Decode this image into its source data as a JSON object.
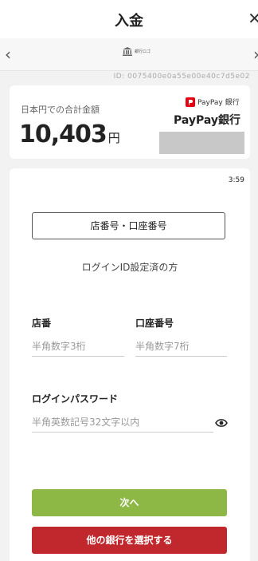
{
  "header": {
    "title": "入金",
    "close_icon": "close-icon"
  },
  "nav": {
    "back_icon": "chevron-left-icon",
    "forward_icon": "chevron-right-icon",
    "bank_logo_text": "銀行ロゴ"
  },
  "session_id": "ID: 0075400e0a55e00e40c7d5e02",
  "balance": {
    "label": "日本円での合計金額",
    "amount": "10,403",
    "currency": "円",
    "provider_logo": "PayPay 銀行",
    "provider_name": "PayPay銀行"
  },
  "form": {
    "timer": "3:59",
    "branch_account_tab": "店番号・口座番号",
    "login_id_link": "ログインID設定済の方",
    "branch_label": "店番",
    "branch_placeholder": "半角数字3桁",
    "account_label": "口座番号",
    "account_placeholder": "半角数字7桁",
    "password_label": "ログインパスワード",
    "password_placeholder": "半角英数記号32文字以内",
    "next_button": "次へ",
    "other_bank_button": "他の銀行を選択する"
  },
  "colors": {
    "next": "#8db845",
    "other_bank": "#c0282d",
    "paypay_red": "#e60012"
  }
}
